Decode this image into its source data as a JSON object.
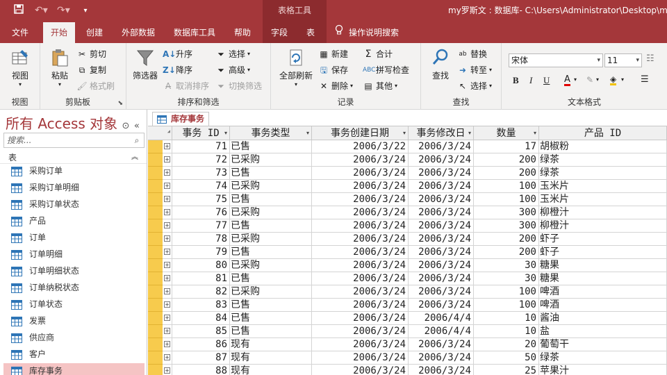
{
  "titlebar": {
    "context_title": "表格工具",
    "window_title": "my罗斯文 : 数据库- C:\\Users\\Administrator\\Desktop\\my"
  },
  "tabs": [
    {
      "label": "文件"
    },
    {
      "label": "开始"
    },
    {
      "label": "创建"
    },
    {
      "label": "外部数据"
    },
    {
      "label": "数据库工具"
    },
    {
      "label": "帮助"
    },
    {
      "label": "字段"
    },
    {
      "label": "表"
    }
  ],
  "tell_me": "操作说明搜索",
  "ribbon": {
    "views": {
      "label": "视图",
      "view_btn": "视图"
    },
    "clipboard": {
      "label": "剪贴板",
      "paste": "粘贴",
      "cut": "剪切",
      "copy": "复制",
      "format_painter": "格式刷"
    },
    "sortfilter": {
      "label": "排序和筛选",
      "filter": "筛选器",
      "asc": "升序",
      "desc": "降序",
      "remove_sort": "取消排序",
      "select": "选择",
      "advanced": "高级",
      "toggle_filter": "切换筛选"
    },
    "records": {
      "label": "记录",
      "refresh": "全部刷新",
      "new": "新建",
      "save": "保存",
      "delete": "删除",
      "totals": "合计",
      "spell": "拼写检查",
      "more": "其他"
    },
    "find": {
      "label": "查找",
      "find": "查找",
      "replace": "替换",
      "goto": "转至",
      "select": "选择"
    },
    "textformat": {
      "label": "文本格式",
      "font": "宋体",
      "size": "11"
    }
  },
  "nav": {
    "title": "所有 Access 对象",
    "search_placeholder": "搜索...",
    "section": "表",
    "items": [
      {
        "label": "采购订单"
      },
      {
        "label": "采购订单明细"
      },
      {
        "label": "采购订单状态"
      },
      {
        "label": "产品"
      },
      {
        "label": "订单"
      },
      {
        "label": "订单明细"
      },
      {
        "label": "订单明细状态"
      },
      {
        "label": "订单纳税状态"
      },
      {
        "label": "订单状态"
      },
      {
        "label": "发票"
      },
      {
        "label": "供应商"
      },
      {
        "label": "客户"
      },
      {
        "label": "库存事务"
      }
    ]
  },
  "doc": {
    "tab_label": "库存事务",
    "columns": [
      "事务 ID",
      "事务类型",
      "事务创建日期",
      "事务修改日",
      "数量",
      "产品 ID"
    ],
    "rows": [
      [
        "71",
        "已售",
        "2006/3/22",
        "2006/3/24",
        "17",
        "胡椒粉"
      ],
      [
        "72",
        "已采购",
        "2006/3/24",
        "2006/3/24",
        "200",
        "绿茶"
      ],
      [
        "73",
        "已售",
        "2006/3/24",
        "2006/3/24",
        "200",
        "绿茶"
      ],
      [
        "74",
        "已采购",
        "2006/3/24",
        "2006/3/24",
        "100",
        "玉米片"
      ],
      [
        "75",
        "已售",
        "2006/3/24",
        "2006/3/24",
        "100",
        "玉米片"
      ],
      [
        "76",
        "已采购",
        "2006/3/24",
        "2006/3/24",
        "300",
        "柳橙汁"
      ],
      [
        "77",
        "已售",
        "2006/3/24",
        "2006/3/24",
        "300",
        "柳橙汁"
      ],
      [
        "78",
        "已采购",
        "2006/3/24",
        "2006/3/24",
        "200",
        "虾子"
      ],
      [
        "79",
        "已售",
        "2006/3/24",
        "2006/3/24",
        "200",
        "虾子"
      ],
      [
        "80",
        "已采购",
        "2006/3/24",
        "2006/3/24",
        "30",
        "糖果"
      ],
      [
        "81",
        "已售",
        "2006/3/24",
        "2006/3/24",
        "30",
        "糖果"
      ],
      [
        "82",
        "已采购",
        "2006/3/24",
        "2006/3/24",
        "100",
        "啤酒"
      ],
      [
        "83",
        "已售",
        "2006/3/24",
        "2006/3/24",
        "100",
        "啤酒"
      ],
      [
        "84",
        "已售",
        "2006/3/24",
        "2006/4/4",
        "10",
        "酱油"
      ],
      [
        "85",
        "已售",
        "2006/3/24",
        "2006/4/4",
        "10",
        "盐"
      ],
      [
        "86",
        "现有",
        "2006/3/24",
        "2006/3/24",
        "20",
        "葡萄干"
      ],
      [
        "87",
        "现有",
        "2006/3/24",
        "2006/3/24",
        "50",
        "绿茶"
      ],
      [
        "88",
        "现有",
        "2006/3/24",
        "2006/3/24",
        "25",
        "苹果汁"
      ]
    ]
  },
  "colors": {
    "accent": "#a4373a",
    "selector": "#f7cb4d",
    "nav_selected": "#f5c4c4"
  }
}
